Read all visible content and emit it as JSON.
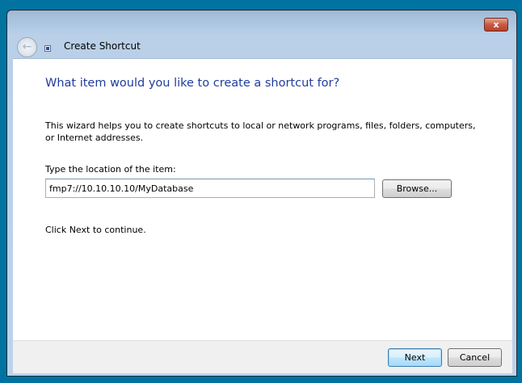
{
  "window": {
    "title": "Create Shortcut",
    "close_label": "x"
  },
  "main": {
    "heading": "What item would you like to create a shortcut for?",
    "description": "This wizard helps you to create shortcuts to local or network programs, files, folders, computers, or Internet addresses.",
    "location_label": "Type the location of the item:",
    "location_value": "fmp7://10.10.10.10/MyDatabase",
    "browse_label": "Browse...",
    "continue_text": "Click Next to continue."
  },
  "footer": {
    "next_label": "Next",
    "cancel_label": "Cancel"
  }
}
